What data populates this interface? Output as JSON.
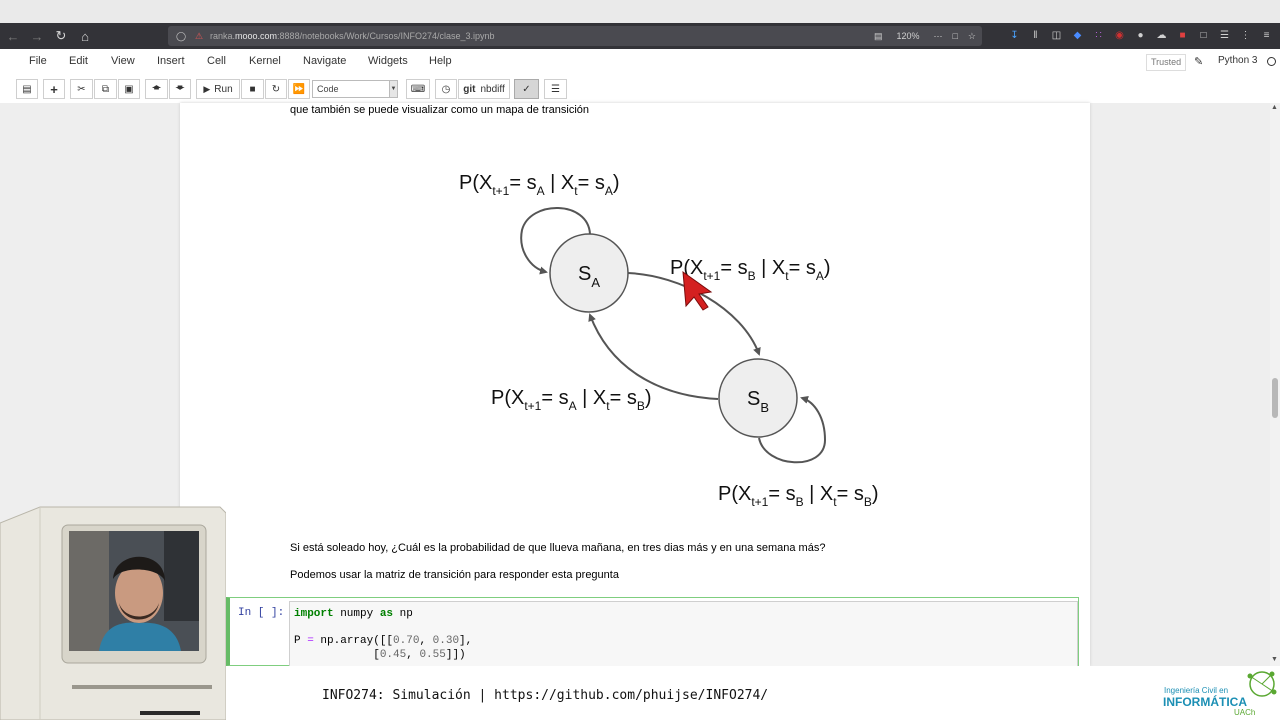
{
  "browser": {
    "url_prefix": "ranka.",
    "url_host": "mooo.com",
    "url_path": ":8888/notebooks/Work/Cursos/INFO274/clase_3.ipynb",
    "zoom": "120%"
  },
  "menu": {
    "items": [
      "File",
      "Edit",
      "View",
      "Insert",
      "Cell",
      "Kernel",
      "Navigate",
      "Widgets",
      "Help"
    ],
    "trusted": "Trusted",
    "kernel": "Python 3"
  },
  "toolbar": {
    "run_label": "Run",
    "cell_type": "Code",
    "nbdiff_label": "nbdiff",
    "git_label": "git"
  },
  "notebook": {
    "intro_text": "que también se puede visualizar como un mapa de transición",
    "question_text": "Si está soleado hoy, ¿Cuál es la probabilidad de que llueva mañana, en tres dias más y en una semana más?",
    "answer_text": "Podemos usar la matriz de transición para responder esta pregunta",
    "diagram": {
      "state_a": "S",
      "state_a_sub": "A",
      "state_b": "S",
      "state_b_sub": "B",
      "labels": {
        "aa": {
          "p": "P(X",
          "t1": "t+1",
          "eq": "= s",
          "to": "A",
          "mid": " | X",
          "t": "t",
          "eq2": "= s",
          "from": "A",
          "close": ")"
        },
        "ab": {
          "p": "P(X",
          "t1": "t+1",
          "eq": "= s",
          "to": "B",
          "mid": " | X",
          "t": "t",
          "eq2": "= s",
          "from": "A",
          "close": ")"
        },
        "ba": {
          "p": "P(X",
          "t1": "t+1",
          "eq": "= s",
          "to": "A",
          "mid": " | X",
          "t": "t",
          "eq2": "= s",
          "from": "B",
          "close": ")"
        },
        "bb": {
          "p": "P(X",
          "t1": "t+1",
          "eq": "= s",
          "to": "B",
          "mid": " | X",
          "t": "t",
          "eq2": "= s",
          "from": "B",
          "close": ")"
        }
      }
    },
    "code_cell": {
      "prompt": "In [ ]:",
      "line1": {
        "kw1": "import",
        "mod": " numpy ",
        "kw2": "as",
        "alias": " np"
      },
      "line3": {
        "var": "P ",
        "op": "=",
        "rest1": " np.array([[",
        "n1": "0.70",
        "sep1": ", ",
        "n2": "0.30",
        "rest2": "],"
      },
      "line4": {
        "indent": "            [",
        "n3": "0.45",
        "sep2": ", ",
        "n4": "0.55",
        "rest3": "]])"
      }
    }
  },
  "footer": {
    "text": "INFO274: Simulación | https://github.com/phuijse/INFO274/"
  },
  "logo": {
    "line1": "Ingeniería Civil en",
    "line2": "INFORMÁTICA",
    "line3": "UACh"
  },
  "colors": {
    "accent_green": "#66bb66",
    "node_fill": "#eeeeee",
    "cursor_red": "#d42020",
    "logo_blue": "#1b8fb4"
  }
}
